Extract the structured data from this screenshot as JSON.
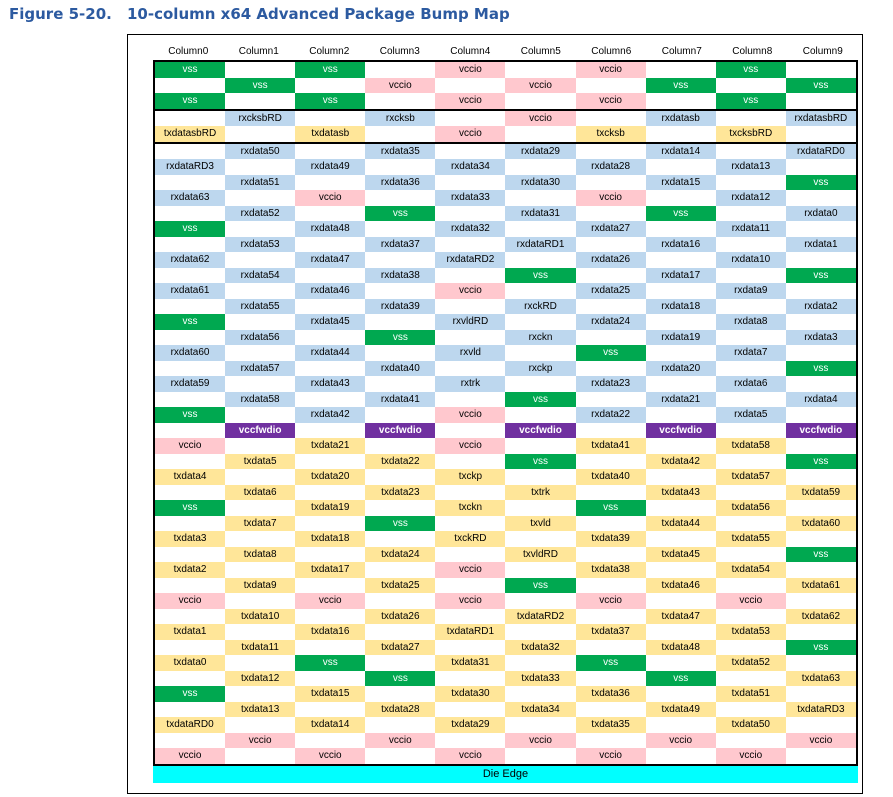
{
  "figure": {
    "number": "Figure 5-20.",
    "title": "10-column x64 Advanced Package Bump Map"
  },
  "columns": [
    "Column0",
    "Column1",
    "Column2",
    "Column3",
    "Column4",
    "Column5",
    "Column6",
    "Column7",
    "Column8",
    "Column9"
  ],
  "die_edge": "Die Edge",
  "colors": {
    "vss": "#00a850",
    "vccio": "#ffc8ce",
    "rx": "#bdd7ee",
    "tx": "#ffe699",
    "vccfwdio": "#7030a0",
    "die_edge": "#00ffff",
    "title": "#2c5aa0"
  },
  "sections": [
    {
      "rows": [
        [
          "vss",
          "",
          "vss",
          "",
          "vccio",
          "",
          "vccio",
          "",
          "vss",
          ""
        ],
        [
          "",
          "vss",
          "",
          "vccio",
          "",
          "vccio",
          "",
          "vss",
          "",
          "vss"
        ],
        [
          "vss",
          "",
          "vss",
          "",
          "vccio",
          "",
          "vccio",
          "",
          "vss",
          ""
        ]
      ]
    },
    {
      "rows": [
        [
          "",
          "rxcksbRD",
          "",
          "rxcksb",
          "",
          "vccio",
          "",
          "rxdatasb",
          "",
          "rxdatasbRD"
        ],
        [
          "txdatasbRD",
          "",
          "txdatasb",
          "",
          "vccio",
          "",
          "txcksb",
          "",
          "txcksbRD",
          ""
        ]
      ]
    },
    {
      "rows": [
        [
          "",
          "rxdata50",
          "",
          "rxdata35",
          "",
          "rxdata29",
          "",
          "rxdata14",
          "",
          "rxdataRD0"
        ],
        [
          "rxdataRD3",
          "",
          "rxdata49",
          "",
          "rxdata34",
          "",
          "rxdata28",
          "",
          "rxdata13",
          ""
        ],
        [
          "",
          "rxdata51",
          "",
          "rxdata36",
          "",
          "rxdata30",
          "",
          "rxdata15",
          "",
          "vss"
        ],
        [
          "rxdata63",
          "",
          "vccio",
          "",
          "rxdata33",
          "",
          "vccio",
          "",
          "rxdata12",
          ""
        ],
        [
          "",
          "rxdata52",
          "",
          "vss",
          "",
          "rxdata31",
          "",
          "vss",
          "",
          "rxdata0"
        ],
        [
          "vss",
          "",
          "rxdata48",
          "",
          "rxdata32",
          "",
          "rxdata27",
          "",
          "rxdata11",
          ""
        ],
        [
          "",
          "rxdata53",
          "",
          "rxdata37",
          "",
          "rxdataRD1",
          "",
          "rxdata16",
          "",
          "rxdata1"
        ],
        [
          "rxdata62",
          "",
          "rxdata47",
          "",
          "rxdataRD2",
          "",
          "rxdata26",
          "",
          "rxdata10",
          ""
        ],
        [
          "",
          "rxdata54",
          "",
          "rxdata38",
          "",
          "vss",
          "",
          "rxdata17",
          "",
          "vss"
        ],
        [
          "rxdata61",
          "",
          "rxdata46",
          "",
          "vccio",
          "",
          "rxdata25",
          "",
          "rxdata9",
          ""
        ],
        [
          "",
          "rxdata55",
          "",
          "rxdata39",
          "",
          "rxckRD",
          "",
          "rxdata18",
          "",
          "rxdata2"
        ],
        [
          "vss",
          "",
          "rxdata45",
          "",
          "rxvldRD",
          "",
          "rxdata24",
          "",
          "rxdata8",
          ""
        ],
        [
          "",
          "rxdata56",
          "",
          "vss",
          "",
          "rxckn",
          "",
          "rxdata19",
          "",
          "rxdata3"
        ],
        [
          "rxdata60",
          "",
          "rxdata44",
          "",
          "rxvld",
          "",
          "vss",
          "",
          "rxdata7",
          ""
        ],
        [
          "",
          "rxdata57",
          "",
          "rxdata40",
          "",
          "rxckp",
          "",
          "rxdata20",
          "",
          "vss"
        ],
        [
          "rxdata59",
          "",
          "rxdata43",
          "",
          "rxtrk",
          "",
          "rxdata23",
          "",
          "rxdata6",
          ""
        ],
        [
          "",
          "rxdata58",
          "",
          "rxdata41",
          "",
          "vss",
          "",
          "rxdata21",
          "",
          "rxdata4"
        ],
        [
          "vss",
          "",
          "rxdata42",
          "",
          "vccio",
          "",
          "rxdata22",
          "",
          "rxdata5",
          ""
        ],
        [
          "",
          "vccfwdio",
          "",
          "vccfwdio",
          "",
          "vccfwdio",
          "",
          "vccfwdio",
          "",
          "vccfwdio"
        ],
        [
          "vccio",
          "",
          "txdata21",
          "",
          "vccio",
          "",
          "txdata41",
          "",
          "txdata58",
          ""
        ],
        [
          "",
          "txdata5",
          "",
          "txdata22",
          "",
          "vss",
          "",
          "txdata42",
          "",
          "vss"
        ],
        [
          "txdata4",
          "",
          "txdata20",
          "",
          "txckp",
          "",
          "txdata40",
          "",
          "txdata57",
          ""
        ],
        [
          "",
          "txdata6",
          "",
          "txdata23",
          "",
          "txtrk",
          "",
          "txdata43",
          "",
          "txdata59"
        ],
        [
          "vss",
          "",
          "txdata19",
          "",
          "txckn",
          "",
          "vss",
          "",
          "txdata56",
          ""
        ],
        [
          "",
          "txdata7",
          "",
          "vss",
          "",
          "txvld",
          "",
          "txdata44",
          "",
          "txdata60"
        ],
        [
          "txdata3",
          "",
          "txdata18",
          "",
          "txckRD",
          "",
          "txdata39",
          "",
          "txdata55",
          ""
        ],
        [
          "",
          "txdata8",
          "",
          "txdata24",
          "",
          "txvldRD",
          "",
          "txdata45",
          "",
          "vss"
        ],
        [
          "txdata2",
          "",
          "txdata17",
          "",
          "vccio",
          "",
          "txdata38",
          "",
          "txdata54",
          ""
        ],
        [
          "",
          "txdata9",
          "",
          "txdata25",
          "",
          "vss",
          "",
          "txdata46",
          "",
          "txdata61"
        ],
        [
          "vccio",
          "",
          "vccio",
          "",
          "vccio",
          "",
          "vccio",
          "",
          "vccio",
          ""
        ],
        [
          "",
          "txdata10",
          "",
          "txdata26",
          "",
          "txdataRD2",
          "",
          "txdata47",
          "",
          "txdata62"
        ],
        [
          "txdata1",
          "",
          "txdata16",
          "",
          "txdataRD1",
          "",
          "txdata37",
          "",
          "txdata53",
          ""
        ],
        [
          "",
          "txdata11",
          "",
          "txdata27",
          "",
          "txdata32",
          "",
          "txdata48",
          "",
          "vss"
        ],
        [
          "txdata0",
          "",
          "vss",
          "",
          "txdata31",
          "",
          "vss",
          "",
          "txdata52",
          ""
        ],
        [
          "",
          "txdata12",
          "",
          "vss",
          "",
          "txdata33",
          "",
          "vss",
          "",
          "txdata63"
        ],
        [
          "vss",
          "",
          "txdata15",
          "",
          "txdata30",
          "",
          "txdata36",
          "",
          "txdata51",
          ""
        ],
        [
          "",
          "txdata13",
          "",
          "txdata28",
          "",
          "txdata34",
          "",
          "txdata49",
          "",
          "txdataRD3"
        ],
        [
          "txdataRD0",
          "",
          "txdata14",
          "",
          "txdata29",
          "",
          "txdata35",
          "",
          "txdata50",
          ""
        ],
        [
          "",
          "vccio",
          "",
          "vccio",
          "",
          "vccio",
          "",
          "vccio",
          "",
          "vccio"
        ],
        [
          "vccio",
          "",
          "vccio",
          "",
          "vccio",
          "",
          "vccio",
          "",
          "vccio",
          ""
        ]
      ]
    }
  ]
}
